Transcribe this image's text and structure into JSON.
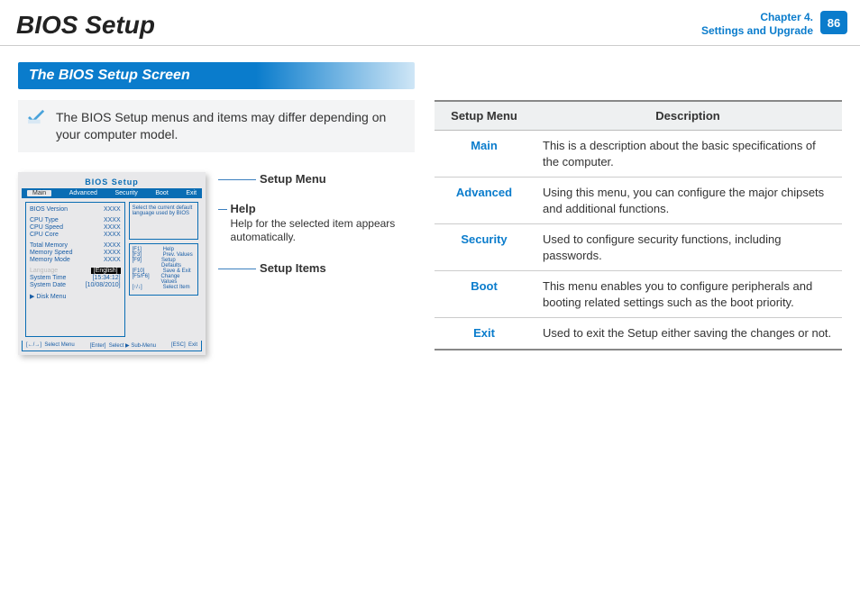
{
  "header": {
    "title": "BIOS Setup",
    "chapter_line1": "Chapter 4.",
    "chapter_line2": "Settings and Upgrade",
    "page_number": "86"
  },
  "section_heading": "The BIOS Setup Screen",
  "note_text": "The BIOS Setup menus and items may differ depending on your computer model.",
  "bios": {
    "title": "BIOS Setup",
    "tabs": [
      "Main",
      "Advanced",
      "Security",
      "Boot",
      "Exit"
    ],
    "active_tab": "Main",
    "items": [
      {
        "label": "BIOS Version",
        "value": "XXXX"
      },
      {
        "label": "CPU Type",
        "value": "XXXX"
      },
      {
        "label": "CPU Speed",
        "value": "XXXX"
      },
      {
        "label": "CPU Core",
        "value": "XXXX"
      },
      {
        "label": "Total Memory",
        "value": "XXXX"
      },
      {
        "label": "Memory Speed",
        "value": "XXXX"
      },
      {
        "label": "Memory Mode",
        "value": "XXXX"
      },
      {
        "label": "Language",
        "value": "[English]",
        "lang": true
      },
      {
        "label": "System Time",
        "value": "[15:34:12]"
      },
      {
        "label": "System Date",
        "value": "[10/08/2010]"
      },
      {
        "label": "▶ Disk Menu",
        "value": ""
      }
    ],
    "help_text": "Select the current default language used by BIOS",
    "keys": [
      {
        "k": "[F1]",
        "d": "Help"
      },
      {
        "k": "[F3]",
        "d": "Prev. Values"
      },
      {
        "k": "[F9]",
        "d": "Setup Defaults"
      },
      {
        "k": "[F10]",
        "d": "Save & Exit"
      },
      {
        "k": "[F5/F6]",
        "d": "Change Values"
      },
      {
        "k": "[↑/↓]",
        "d": "Select Item"
      },
      {
        "k": "[←/→]",
        "d": "Select Menu"
      },
      {
        "k": "[Enter]",
        "d": "Select ▶ Sub-Menu"
      },
      {
        "k": "[ESC]",
        "d": "Exit"
      }
    ]
  },
  "callouts": {
    "menu_label": "Setup Menu",
    "help_label": "Help",
    "help_text": "Help for the selected item appears automatically.",
    "items_label": "Setup Items"
  },
  "table": {
    "header_menu": "Setup Menu",
    "header_desc": "Description",
    "rows": [
      {
        "menu": "Main",
        "desc": "This is a description about the basic specifications of the computer."
      },
      {
        "menu": "Advanced",
        "desc": "Using this menu, you can configure the major chipsets and additional functions."
      },
      {
        "menu": "Security",
        "desc": "Used to configure security functions, including passwords."
      },
      {
        "menu": "Boot",
        "desc": "This menu enables you to configure peripherals and booting related settings such as the boot priority."
      },
      {
        "menu": "Exit",
        "desc": "Used to exit the Setup either saving the changes or not."
      }
    ]
  }
}
